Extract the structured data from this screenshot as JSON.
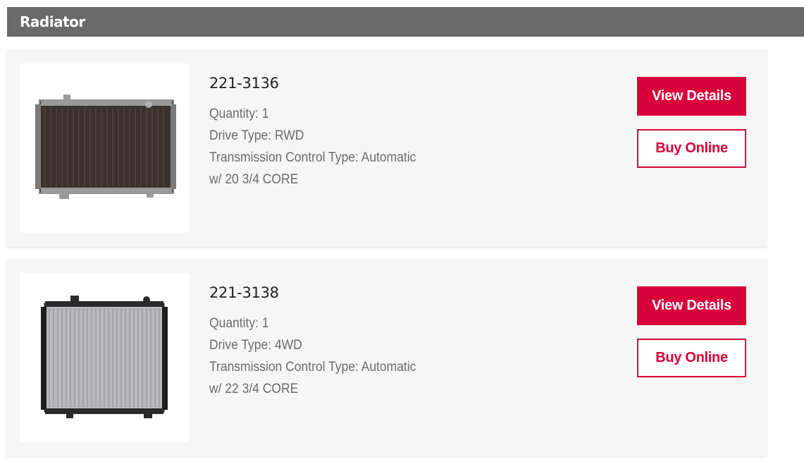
{
  "section": {
    "title": "Radiator"
  },
  "colors": {
    "header_bg": "#6a6a6a",
    "accent": "#d9003a",
    "card_bg": "#f6f6f6"
  },
  "products": [
    {
      "part_number": "221-3136",
      "image_icon": "radiator-image",
      "specs": [
        "Quantity: 1",
        "Drive Type: RWD",
        "Transmission Control Type: Automatic",
        "w/ 20 3/4 CORE"
      ],
      "view_details_label": "View Details",
      "buy_online_label": "Buy Online"
    },
    {
      "part_number": "221-3138",
      "image_icon": "radiator-image",
      "specs": [
        "Quantity: 1",
        "Drive Type: 4WD",
        "Transmission Control Type: Automatic",
        "w/ 22 3/4 CORE"
      ],
      "view_details_label": "View Details",
      "buy_online_label": "Buy Online"
    }
  ]
}
